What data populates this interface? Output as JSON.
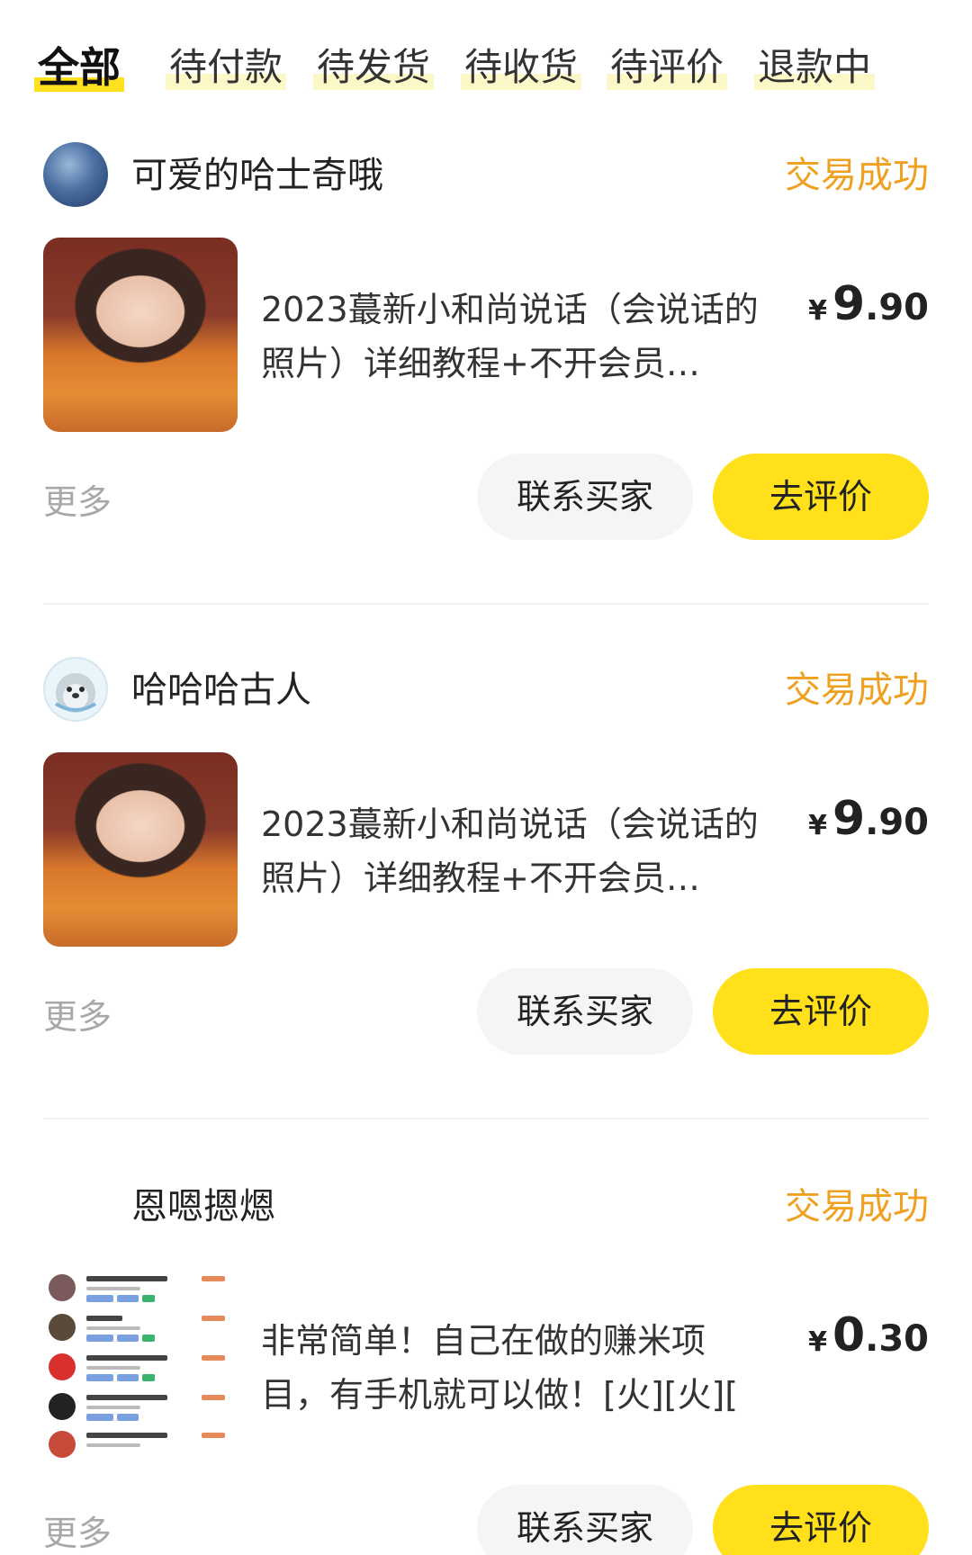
{
  "tabs": [
    {
      "label": "全部",
      "active": true
    },
    {
      "label": "待付款",
      "active": false
    },
    {
      "label": "待发货",
      "active": false
    },
    {
      "label": "待收货",
      "active": false
    },
    {
      "label": "待评价",
      "active": false
    },
    {
      "label": "退款中",
      "active": false
    }
  ],
  "orders": [
    {
      "seller": "可爱的哈士奇哦",
      "status": "交易成功",
      "title": "2023蕞新小和尚说话（会说话的照片）详细教程+不开会员…",
      "price_symbol": "¥",
      "price_int": "9",
      "price_dec": ".90",
      "more": "更多",
      "contact_label": "联系买家",
      "review_label": "去评价"
    },
    {
      "seller": "哈哈哈古人",
      "status": "交易成功",
      "title": "2023蕞新小和尚说话（会说话的照片）详细教程+不开会员…",
      "price_symbol": "¥",
      "price_int": "9",
      "price_dec": ".90",
      "more": "更多",
      "contact_label": "联系买家",
      "review_label": "去评价"
    },
    {
      "seller": "恩嗯摁煾",
      "status": "交易成功",
      "title": "非常简单！自己在做的赚米项目，有手机就可以做！[火][火][",
      "price_symbol": "¥",
      "price_int": "0",
      "price_dec": ".30",
      "more": "更多",
      "contact_label": "联系买家",
      "review_label": "去评价"
    }
  ],
  "colors": {
    "accent_yellow": "#ffe01b",
    "status_orange": "#f0a020",
    "muted_gray": "#a8a8a8"
  }
}
